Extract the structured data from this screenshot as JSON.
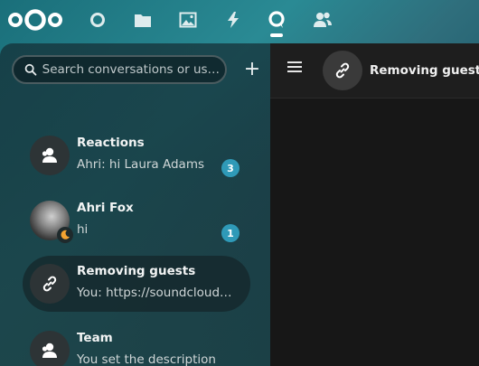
{
  "topbar": {
    "apps": [
      {
        "name": "dashboard",
        "icon": "circle-icon"
      },
      {
        "name": "files",
        "icon": "folder-icon"
      },
      {
        "name": "photos",
        "icon": "image-icon"
      },
      {
        "name": "activity",
        "icon": "lightning-icon"
      },
      {
        "name": "talk",
        "icon": "talk-bubble-icon",
        "active": true
      },
      {
        "name": "contacts",
        "icon": "contacts-icon"
      }
    ]
  },
  "sidebar": {
    "search_placeholder": "Search conversations or us…",
    "new_conversation_label": "+",
    "conversations": [
      {
        "title": "Reactions",
        "subtitle": "Ahri: hi Laura Adams",
        "badge": "3",
        "avatar_icon": "group-icon"
      },
      {
        "title": "Ahri Fox",
        "subtitle": "hi",
        "badge": "1",
        "avatar_icon": "user-photo",
        "status_icon": "moon-icon"
      },
      {
        "title": "Removing guests",
        "subtitle": "You: https://soundcloud.com",
        "avatar_icon": "link-icon",
        "selected": true
      },
      {
        "title": "Team",
        "subtitle": "You set the description",
        "avatar_icon": "group-icon"
      }
    ]
  },
  "room": {
    "title": "Removing guests",
    "avatar_icon": "link-icon"
  },
  "colors": {
    "badge": "#2f9ab8",
    "right_panel_bg": "#171717"
  }
}
